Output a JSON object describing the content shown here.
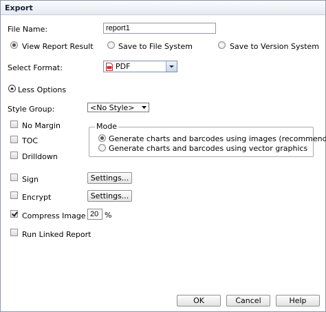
{
  "window": {
    "title": "Export"
  },
  "file_name": {
    "label": "File Name:",
    "value": "report1"
  },
  "destinations": [
    {
      "label": "View Report Result",
      "selected": true
    },
    {
      "label": "Save to File System",
      "selected": false
    },
    {
      "label": "Save to Version System",
      "selected": false
    }
  ],
  "format": {
    "label": "Select Format:",
    "value": "PDF",
    "icon": "pdf-file-icon"
  },
  "options_toggle": {
    "label": "Less Options",
    "icon": "collapse-triangle-icon"
  },
  "style_group": {
    "label": "Style Group:",
    "value": "<No Style>"
  },
  "checkboxes": {
    "no_margin": {
      "label": "No Margin",
      "checked": false
    },
    "toc": {
      "label": "TOC",
      "checked": false
    },
    "drilldown": {
      "label": "Drilldown",
      "checked": false
    },
    "sign": {
      "label": "Sign",
      "checked": false
    },
    "encrypt": {
      "label": "Encrypt",
      "checked": false
    },
    "compress_image": {
      "label": "Compress Image",
      "checked": true
    },
    "run_linked_report": {
      "label": "Run Linked Report",
      "checked": false
    }
  },
  "mode": {
    "legend": "Mode",
    "options": [
      {
        "label": "Generate charts and barcodes using images (recommended)",
        "selected": true
      },
      {
        "label": "Generate charts and barcodes using vector graphics",
        "selected": false
      }
    ]
  },
  "settings_button_label": "Settings...",
  "compress": {
    "value": "20",
    "unit": "%"
  },
  "buttons": {
    "ok": "OK",
    "cancel": "Cancel",
    "help": "Help"
  },
  "colors": {
    "title_text": "#15233a",
    "border": "#8c97a8",
    "pdf_red": "#d22a2a"
  }
}
